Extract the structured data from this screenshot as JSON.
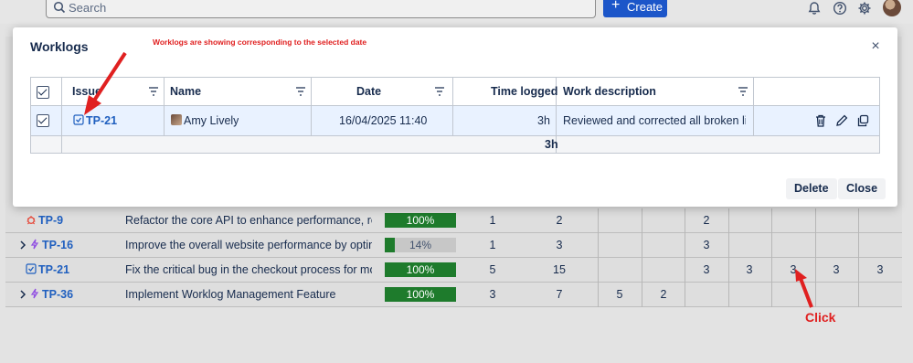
{
  "topbar": {
    "search_placeholder": "Search",
    "create_label": "Create",
    "create_color": "#1c56c9",
    "icons": [
      "bell-icon",
      "help-icon",
      "gear-icon"
    ]
  },
  "modal": {
    "title": "Worklogs",
    "annotation": "Worklogs are showing corresponding to the selected date",
    "columns": [
      "Issue",
      "Name",
      "Date",
      "Time logged",
      "Work description"
    ],
    "row": {
      "issue": "TP-21",
      "name": "Amy Lively",
      "date": "16/04/2025 11:40",
      "time_logged": "3h",
      "description": "Reviewed and corrected all broken lin..."
    },
    "total": "3h",
    "delete_label": "Delete",
    "close_label": "Close"
  },
  "background_rows": [
    {
      "key": "TP-9",
      "summary": "Refactor the core API to enhance performance, red...",
      "progress": "100%",
      "progress_value": 1.0,
      "est": "1",
      "logged": "2",
      "cells": [
        "",
        "",
        "2",
        "",
        "",
        "",
        "",
        ""
      ]
    },
    {
      "key": "TP-16",
      "summary": "Improve the overall website performance by optimiz...",
      "progress": "14%",
      "progress_value": 0.14,
      "est": "1",
      "logged": "3",
      "cells": [
        "",
        "",
        "3",
        "",
        "",
        "",
        "",
        ""
      ]
    },
    {
      "key": "TP-21",
      "summary": "Fix the critical bug in the checkout process for mobi...",
      "progress": "100%",
      "progress_value": 1.0,
      "est": "5",
      "logged": "15",
      "cells": [
        "",
        "",
        "3",
        "3",
        "3",
        "3",
        "3"
      ]
    },
    {
      "key": "TP-36",
      "summary": "Implement Worklog Management Feature",
      "progress": "100%",
      "progress_value": 1.0,
      "est": "3",
      "logged": "7",
      "cells": [
        "5",
        "2",
        "",
        "",
        "",
        "",
        ""
      ]
    }
  ],
  "click_annotation": "Click",
  "colors": {
    "accent": "#1c56c9",
    "progress_fill": "#1e7b2c",
    "annotation": "#e02020",
    "row_selected": "#e9f2ff"
  }
}
